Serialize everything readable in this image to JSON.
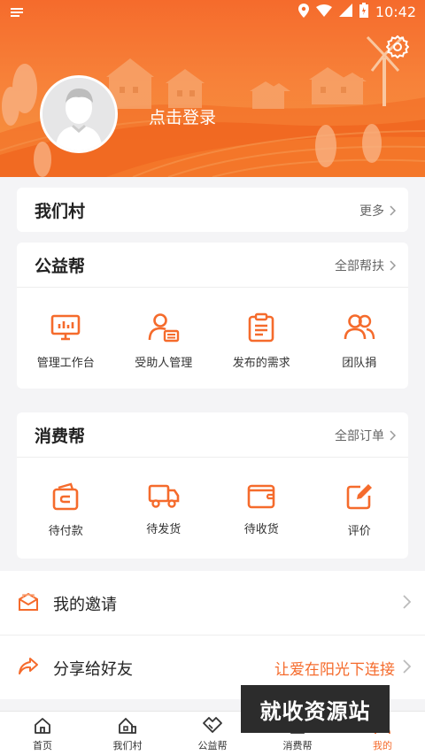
{
  "status_bar": {
    "time": "10:42"
  },
  "profile": {
    "login_text": "点击登录"
  },
  "village_card": {
    "title": "我们村",
    "more": "更多"
  },
  "charity_card": {
    "title": "公益帮",
    "more": "全部帮扶",
    "items": [
      {
        "label": "管理工作台",
        "icon": "monitor-chart-icon"
      },
      {
        "label": "受助人管理",
        "icon": "person-card-icon"
      },
      {
        "label": "发布的需求",
        "icon": "clipboard-icon"
      },
      {
        "label": "团队捐",
        "icon": "team-icon"
      }
    ]
  },
  "consume_card": {
    "title": "消费帮",
    "more": "全部订单",
    "items": [
      {
        "label": "待付款",
        "icon": "wallet-icon"
      },
      {
        "label": "待发货",
        "icon": "truck-icon"
      },
      {
        "label": "待收货",
        "icon": "box-icon"
      },
      {
        "label": "评价",
        "icon": "edit-icon"
      }
    ]
  },
  "list": {
    "invite": {
      "label": "我的邀请"
    },
    "share": {
      "label": "分享给好友",
      "extra": "让爱在阳光下连接"
    }
  },
  "watermark": "就收资源站",
  "tabs": [
    {
      "label": "首页",
      "icon": "home-icon"
    },
    {
      "label": "我们村",
      "icon": "village-home-icon"
    },
    {
      "label": "公益帮",
      "icon": "handshake-icon"
    },
    {
      "label": "消费帮",
      "icon": "shop-icon"
    },
    {
      "label": "我的",
      "icon": "user-icon",
      "active": true
    }
  ],
  "colors": {
    "accent": "#f56b2c",
    "background": "#f4f4f6"
  }
}
